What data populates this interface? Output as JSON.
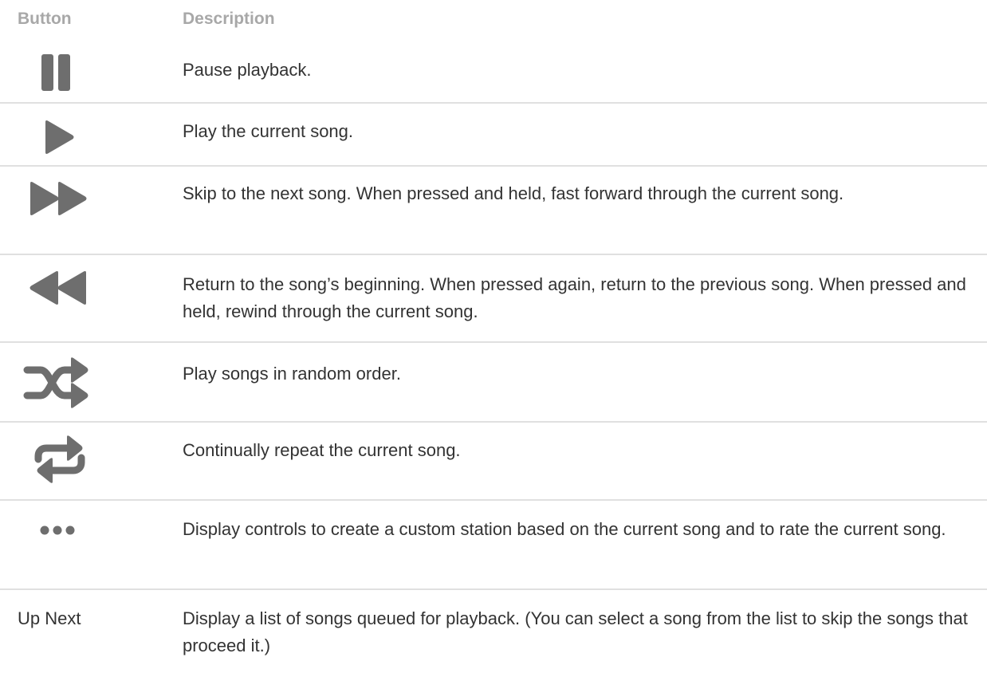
{
  "header": {
    "button_col": "Button",
    "description_col": "Description"
  },
  "rows": [
    {
      "icon": "pause-icon",
      "description": "Pause playback."
    },
    {
      "icon": "play-icon",
      "description": "Play the current song."
    },
    {
      "icon": "fast-forward-icon",
      "description": "Skip to the next song. When pressed and held, fast forward through the current song."
    },
    {
      "icon": "rewind-icon",
      "description": "Return to the song’s beginning. When pressed again, return to the previous song. When pressed and held, rewind through the current song."
    },
    {
      "icon": "shuffle-icon",
      "description": "Play songs in random order."
    },
    {
      "icon": "repeat-icon",
      "description": "Continually repeat the current song."
    },
    {
      "icon": "more-icon",
      "description": "Display controls to create a custom station based on the current song and to rate the current song."
    },
    {
      "button_label": "Up Next",
      "description": "Display a list of songs queued for playback. (You can select a song from the list to skip the songs that proceed it.)"
    }
  ],
  "colors": {
    "icon": "#6e6e6e",
    "header_text": "#a8a8a8",
    "body_text": "#333333",
    "divider": "#e0e0e0"
  }
}
